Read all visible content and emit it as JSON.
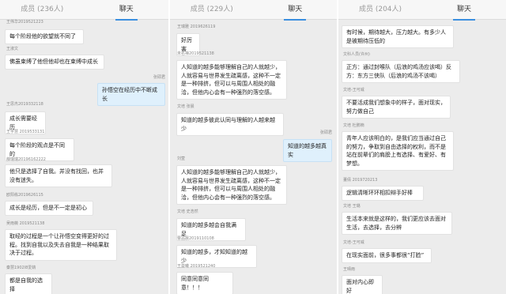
{
  "screens": [
    {
      "tabs": {
        "members": "成员 (236人)",
        "chat": "聊天"
      },
      "messages": [
        {
          "name": "王伟华2019521223",
          "text": "每个阶段他的欲望就不同了"
        },
        {
          "name": "王淑文",
          "text": "佛虽束缚了他但他却也在束缚中成长"
        },
        {
          "name": "张硕君",
          "text": "孙悟空在经历中不断成长"
        },
        {
          "name": "王思杰2019332118",
          "text": "成长需要经历"
        },
        {
          "name": "王宇慧 2019533131",
          "text": "每个阶段的观点是不同的"
        },
        {
          "name": "薛瑞瑞20196162222",
          "text": "他只是选择了自我。并没有找回，也并没有迷失。"
        },
        {
          "name": "欧阳栋2019626115",
          "text": "成长是经历，但是不一定是初心"
        },
        {
          "name": "吴雨薇 2019521138",
          "text": "取经的过程是一个让孙悟空变得更好的过程。找到自我以及失去自我是一种结果取决于过程。"
        },
        {
          "name": "秦慧1902l8爱婧",
          "text": "都是自我的选择"
        }
      ]
    },
    {
      "tabs": {
        "members": "成员 (229人)",
        "chat": "聊天"
      },
      "messages": [
        {
          "name": "王瑞雅 2019626119",
          "text": "好厉害"
        },
        {
          "name": "未名禅2019521138",
          "text": "人知道的越多能够理解自己的人就越少，人就容易与世界发生疏离感，这种不一定是一种排挤，但可以与周围人相处的融洽，但他内心会有一种强烈的落空感。"
        },
        {
          "name": "文培 张晨",
          "text": "知道的越多彼此认同与理解的人越来越少"
        },
        {
          "name": "张硕君",
          "text": "知道的越多越真实"
        },
        {
          "name": "刘萱",
          "text": "人知道的越多能够理解自己的人就越少，人就容易与世界发生疏离感，这种不一定是一种排挤，但可以与周围人相处的融洽，但他内心会有一种强烈的落空感。"
        },
        {
          "name": "文培 史浩然",
          "text": "知道的越多越会自我满足"
        },
        {
          "name": "曹品晨2019110108",
          "text": "知道的越多，才知知道的越少"
        },
        {
          "name": "王曼曦 2019521240",
          "text": "同意同意同意！！！"
        }
      ]
    },
    {
      "tabs": {
        "members": "成员 (204人)",
        "chat": "聊天"
      },
      "messages": [
        {
          "name": "",
          "text": "有时候，期待越大，压力越大。有多少人是被期待压低的"
        },
        {
          "name": "文科人员(许州)",
          "text": "正方：通过封喉队（后浪的鸡汤应该喝）反方：东方三侠队（后浪的鸡汤不该喝）"
        },
        {
          "name": "文培-王可威",
          "text": "不要活成我们想象中的样子，面对现实，努力做自己"
        },
        {
          "name": "文培 杜鹏楠",
          "text": "青年人应该明白的，是我们应当通过自己的努力，争取到自由选择的权利，而不是站在前辈们的肩膀上有选择、有爱好、有梦想。"
        },
        {
          "name": "董倩 2019720213",
          "text": "逻辑清晰环环相扣辩手好棒"
        },
        {
          "name": "文培 王璐",
          "text": "生活本来就是这样的，我们更应该去面对生活，去选择，去分辨"
        },
        {
          "name": "文培-王可威",
          "text": "在现实面前，很多事都很“打脸”"
        },
        {
          "name": "王晴雨",
          "text": "面对内心即好"
        }
      ]
    }
  ]
}
